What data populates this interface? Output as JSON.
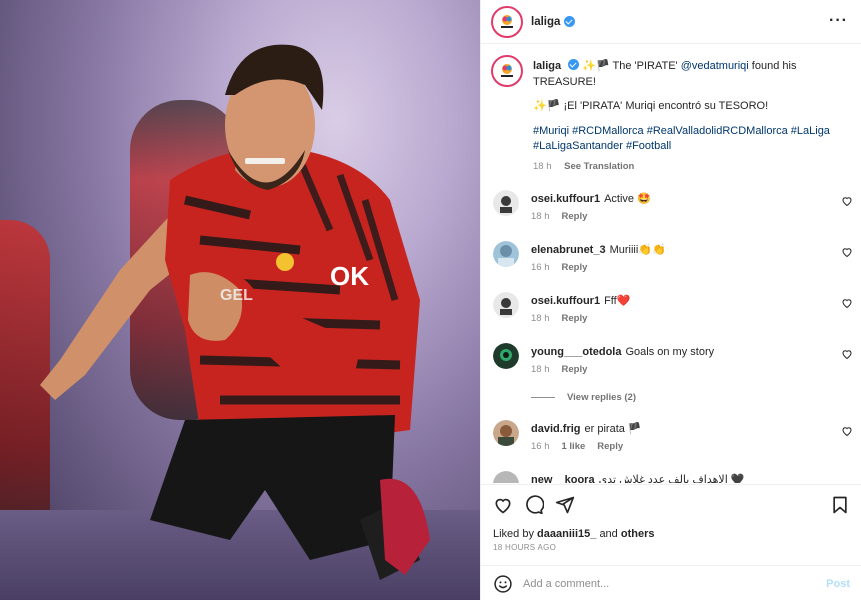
{
  "header": {
    "username": "laliga"
  },
  "caption": {
    "username": "laliga",
    "line1_emoji": "✨🏴",
    "line1_text": "The 'PIRATE'",
    "line1_mention": "@vedatmuriqi",
    "line1_tail": "found his TREASURE!",
    "line2_emoji": "✨🏴",
    "line2_text": "¡El 'PIRATA' Muriqi encontró su TESORO!",
    "hashtags_line1": "#Muriqi #RCDMallorca #RealValladolidRCDMallorca #LaLiga",
    "hashtags_line2": "#LaLigaSantander #Football",
    "time": "18 h",
    "see_translation": "See Translation"
  },
  "comments": [
    {
      "user": "osei.kuffour1",
      "text": "Active 🤩",
      "time": "18 h",
      "likes": "",
      "reply": "Reply"
    },
    {
      "user": "elenabrunet_3",
      "text": "Muriiii👏👏",
      "time": "16 h",
      "likes": "",
      "reply": "Reply"
    },
    {
      "user": "osei.kuffour1",
      "text": "Fff❤️",
      "time": "18 h",
      "likes": "",
      "reply": "Reply"
    },
    {
      "user": "young___otedola",
      "text": "Goals on my story",
      "time": "18 h",
      "likes": "",
      "reply": "Reply"
    },
    {
      "user": "david.frig",
      "text": "er pirata 🏴",
      "time": "16 h",
      "likes": "1 like",
      "reply": "Reply"
    },
    {
      "user": "new__koora",
      "text": "الاهداف بالف عدد غلاش تدي 🖤",
      "time": "",
      "likes": "",
      "reply": ""
    }
  ],
  "view_replies": "View replies (2)",
  "likes": {
    "prefix": "Liked by",
    "user": "daaaniii15_",
    "mid": "and",
    "others": "others"
  },
  "time_ago": "18 HOURS AGO",
  "add_comment": {
    "placeholder": "Add a comment...",
    "post": "Post"
  },
  "colors": {
    "link": "#00376b",
    "post_disabled": "#b2dffc",
    "verified": "#3897f0",
    "ring": "#e23a6a"
  }
}
